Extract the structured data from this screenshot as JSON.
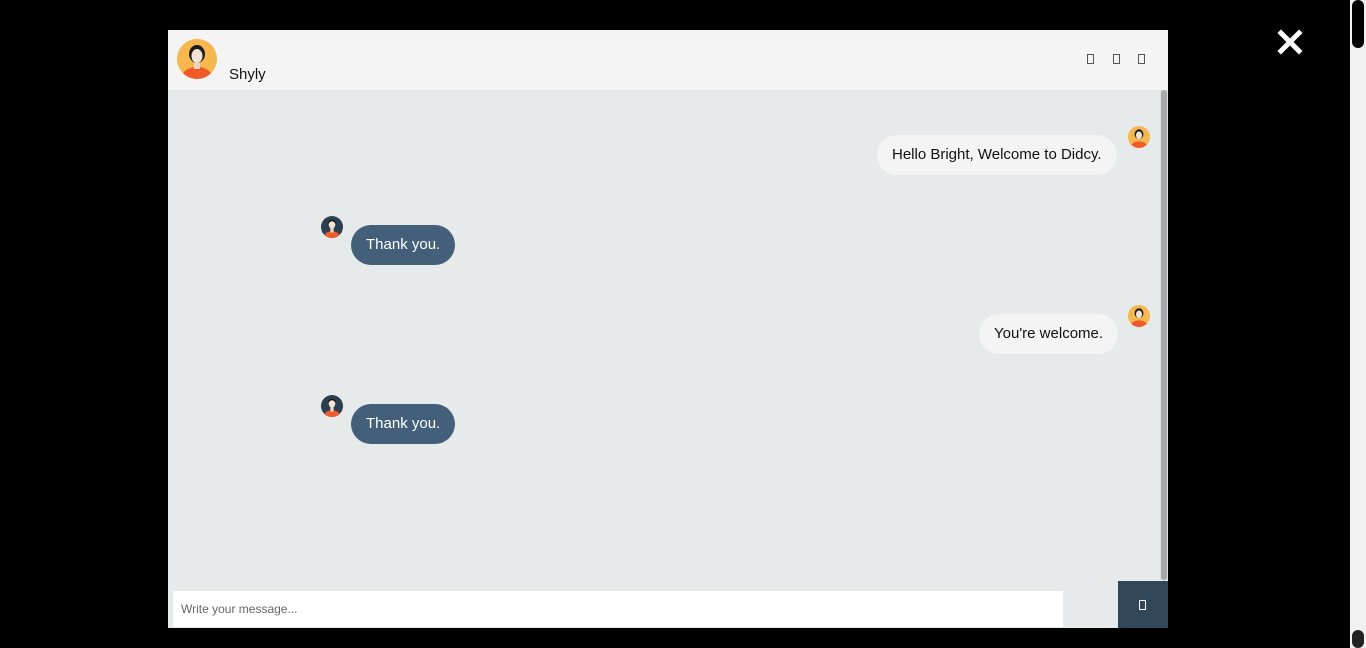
{
  "contact": {
    "name": "Shyly",
    "avatar_icon": "female-avatar-icon"
  },
  "header": {
    "icons": [
      "facebook-icon",
      "twitter-icon",
      "instagram-icon"
    ]
  },
  "messages": [
    {
      "direction": "sent",
      "text": "Hello Bright, Welcome to Didcy.",
      "avatar_icon": "female-avatar-icon"
    },
    {
      "direction": "received",
      "text": "Thank you.",
      "avatar_icon": "male-avatar-icon"
    },
    {
      "direction": "sent",
      "text": "You're welcome.",
      "avatar_icon": "female-avatar-icon"
    },
    {
      "direction": "received",
      "text": "Thank you.",
      "avatar_icon": "male-avatar-icon"
    }
  ],
  "composer": {
    "placeholder": "Write your message...",
    "value": "",
    "send_icon": "paper-plane-icon"
  },
  "overlay": {
    "close_icon": "close-icon"
  },
  "colors": {
    "backdrop": "#000000",
    "chat_bg": "#e6eaea",
    "header_bg": "#f4f4f4",
    "sent_bubble": "#f4f4f4",
    "received_bubble": "#435f7a",
    "send_button": "#32465a",
    "avatar_yellow": "#f5b74e",
    "avatar_navy": "#2c3e50",
    "avatar_orange": "#f05a28"
  }
}
